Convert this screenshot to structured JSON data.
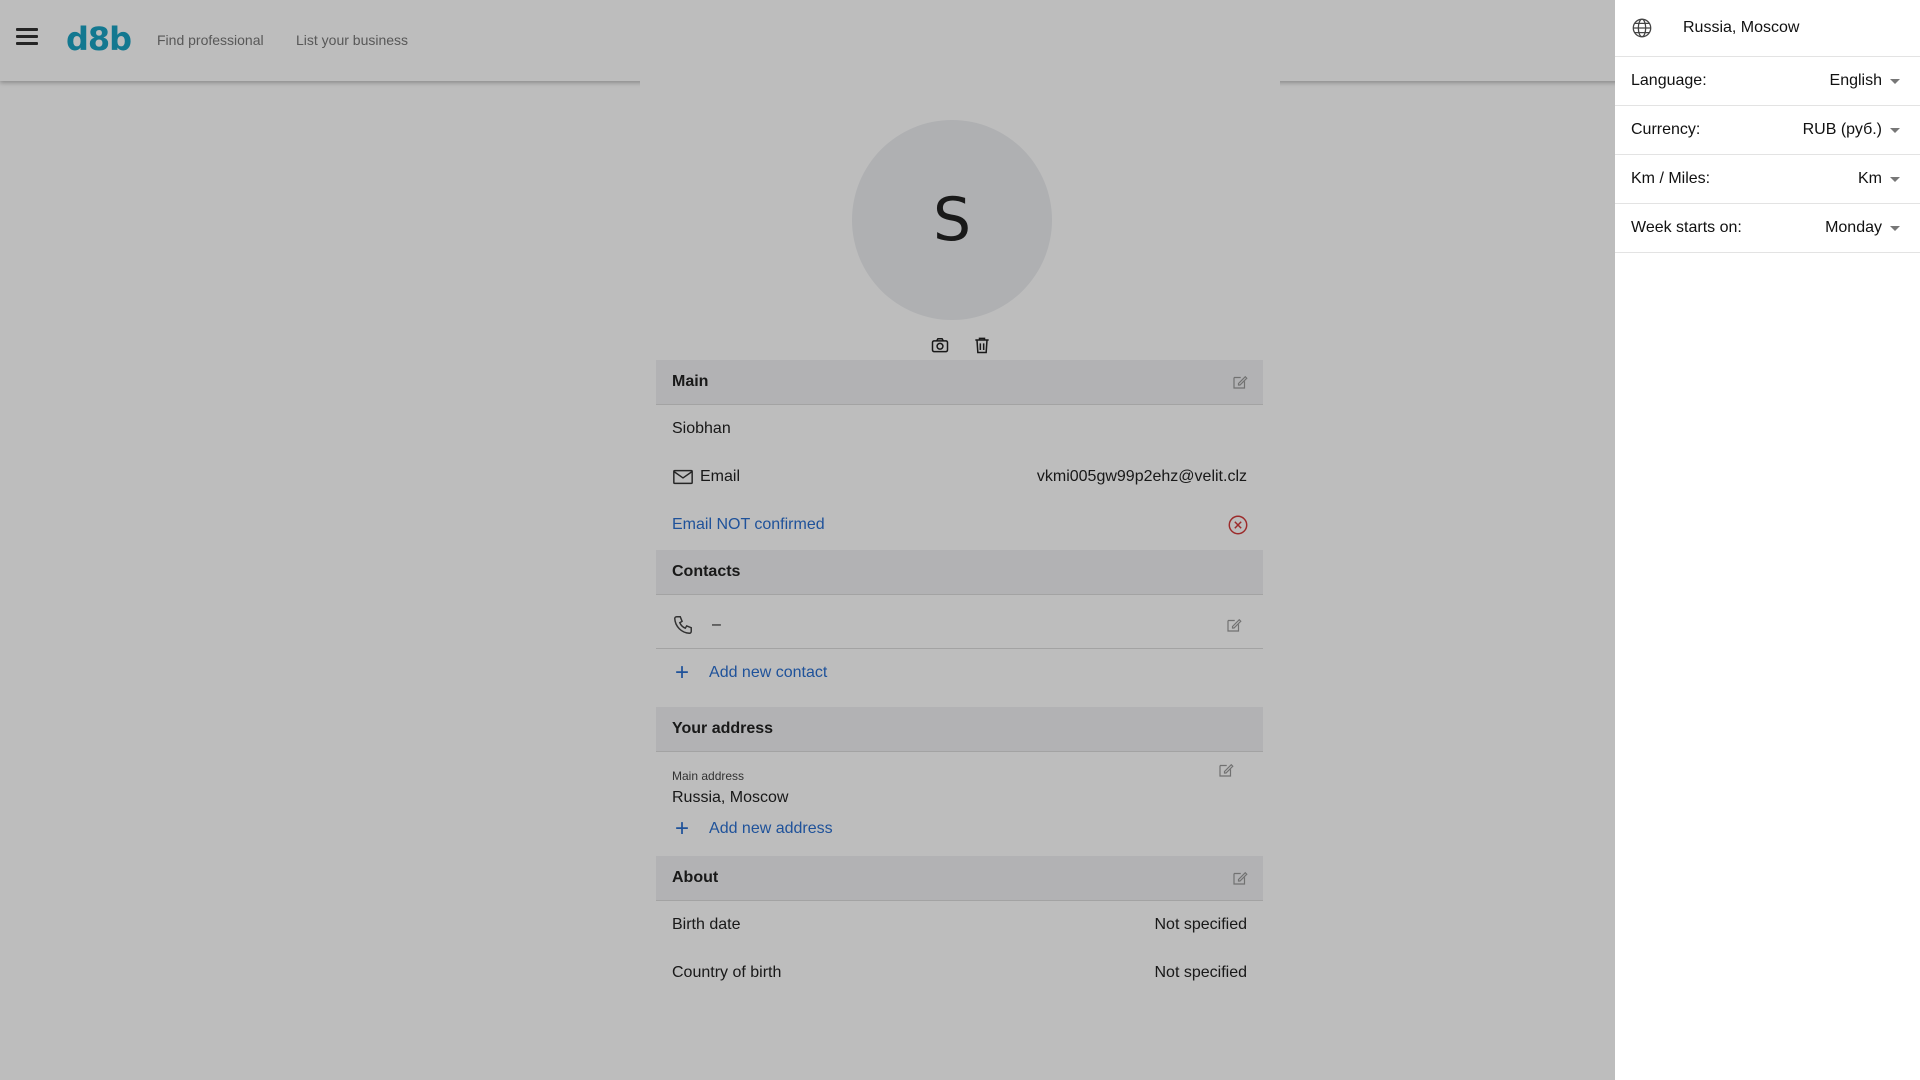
{
  "header": {
    "logo": "d8b",
    "nav": [
      "Find professional",
      "List your business"
    ]
  },
  "profile": {
    "avatar_letter": "S",
    "main": {
      "title": "Main",
      "name": "Siobhan",
      "email_label": "Email",
      "email_value": "vkmi005gw99p2ehz@velit.clz",
      "email_status": "Email NOT confirmed"
    },
    "contacts": {
      "title": "Contacts",
      "phone_value": "–",
      "add_label": "Add new contact"
    },
    "address": {
      "title": "Your address",
      "main_label": "Main address",
      "main_value": "Russia, Moscow",
      "add_label": "Add new address"
    },
    "about": {
      "title": "About",
      "birth_date_label": "Birth date",
      "birth_date_value": "Not specified",
      "country_label": "Country of birth",
      "country_value": "Not specified"
    }
  },
  "drawer": {
    "location": "Russia, Moscow",
    "settings": [
      {
        "label": "Language:",
        "value": "English"
      },
      {
        "label": "Currency:",
        "value": "RUB (руб.)"
      },
      {
        "label": "Km / Miles:",
        "value": "Km"
      },
      {
        "label": "Week starts on:",
        "value": "Monday"
      }
    ]
  },
  "colors": {
    "brand": "#1aa2c3",
    "link": "#2a6fd0",
    "error": "#d33a3a"
  }
}
